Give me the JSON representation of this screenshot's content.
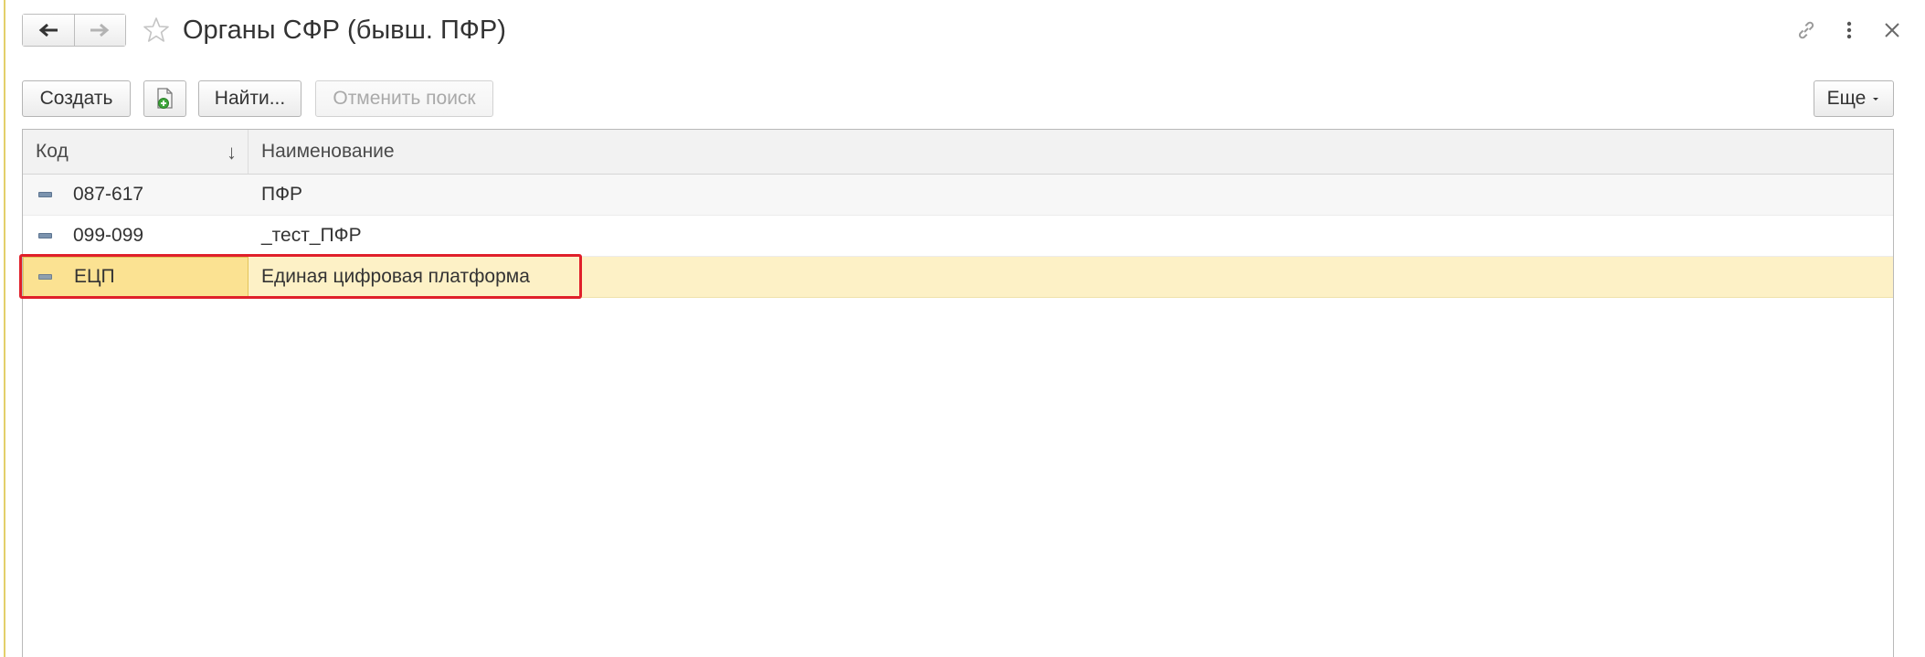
{
  "window": {
    "title": "Органы СФР (бывш. ПФР)"
  },
  "nav": {
    "back_icon": "arrow-left-icon",
    "forward_icon": "arrow-right-icon",
    "favorite_icon": "star-outline-icon"
  },
  "title_actions": {
    "link_icon": "link-icon",
    "menu_icon": "more-vertical-icon",
    "close_icon": "close-icon"
  },
  "toolbar": {
    "create_label": "Создать",
    "copy_icon": "document-add-icon",
    "find_label": "Найти...",
    "cancel_search_label": "Отменить поиск",
    "more_label": "Еще"
  },
  "table": {
    "columns": {
      "code": "Код",
      "name": "Наименование"
    },
    "sort_indicator": "↓",
    "rows": [
      {
        "code": "087-617",
        "name": "ПФР"
      },
      {
        "code": "099-099",
        "name": "_тест_ПФР"
      },
      {
        "code": "ЕЦП",
        "name": "Единая цифровая платформа"
      }
    ]
  },
  "colors": {
    "selected_row": "#fdf1c6",
    "selected_cell": "#fbe292",
    "highlight_frame": "#e0202a",
    "row_icon": "#7b93ae"
  }
}
